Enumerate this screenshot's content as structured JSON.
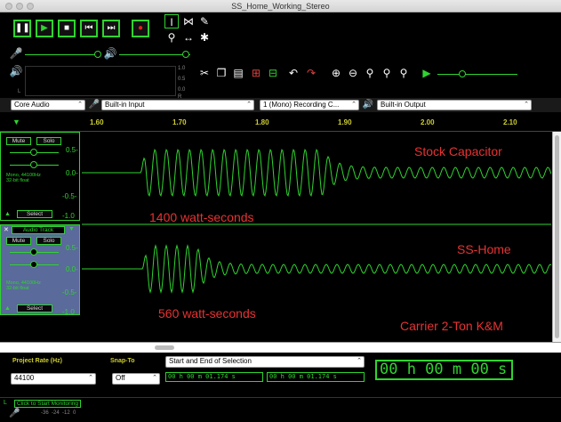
{
  "window": {
    "title": "SS_Home_Working_Stereo"
  },
  "transport": {
    "pause_icon": "pause-icon",
    "play_icon": "play-icon",
    "stop_icon": "stop-icon",
    "skip_start_icon": "skip-start-icon",
    "skip_end_icon": "skip-end-icon",
    "record_icon": "record-icon"
  },
  "meter_scale": {
    "top": "1.0",
    "mid": "0.5",
    "zero": "0.0",
    "L": "L",
    "R": "R"
  },
  "devices": {
    "host": "Core Audio",
    "input": "Built-in Input",
    "channels": "1 (Mono) Recording C...",
    "output": "Built-in Output"
  },
  "ruler": {
    "ticks": [
      "1.60",
      "1.70",
      "1.80",
      "1.90",
      "2.00",
      "2.10"
    ]
  },
  "tracks": [
    {
      "mute": "Mute",
      "solo": "Solo",
      "info": "Mono, 44100Hz\n32-bit float",
      "select": "Select",
      "scale": [
        "0.5-",
        "0.0-",
        "-0.5-",
        "-1.0"
      ],
      "label_top": "Stock Capacitor",
      "label_bottom": "1400 watt-seconds"
    },
    {
      "name": "Audio Track",
      "mute": "Mute",
      "solo": "Solo",
      "info": "Mono, 44100Hz\n32-bit float",
      "select": "Select",
      "scale": [
        "0.5-",
        "0.0-",
        "-0.5-",
        "-1.0"
      ],
      "label_top": "SS-Home",
      "label_bottom": "560 watt-seconds",
      "label_extra": "Carrier 2-Ton K&M"
    }
  ],
  "selection": {
    "project_rate_label": "Project Rate (Hz)",
    "project_rate": "44100",
    "snap_label": "Snap-To",
    "snap_value": "Off",
    "mode": "Start and End of Selection",
    "start": "00 h 00 m 01.174 s",
    "end": "00 h 00 m 01.174 s",
    "position": "00 h 00 m 00 s"
  },
  "status": {
    "monitor": "Click to Start Monitoring",
    "meter_ticks": "-36  -24  -12  0"
  }
}
